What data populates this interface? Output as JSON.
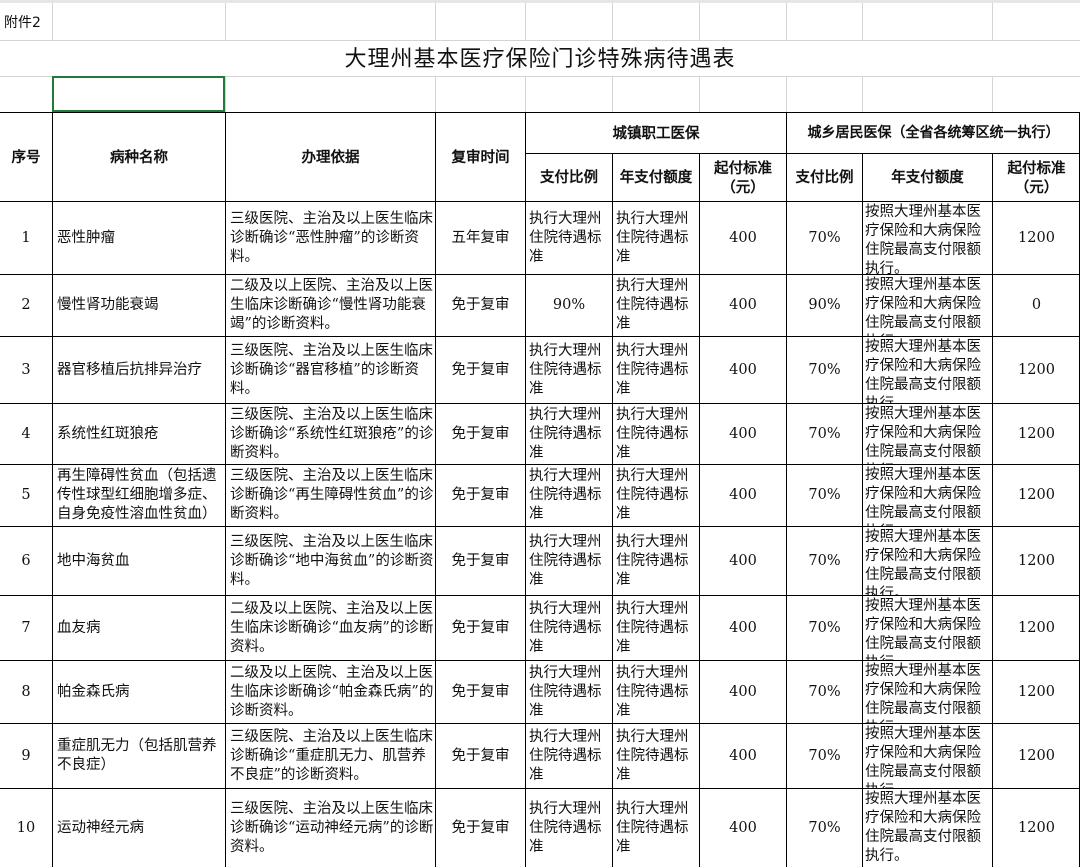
{
  "annex_label": "附件2",
  "title": "大理州基本医疗保险门诊特殊病待遇表",
  "headers": {
    "seq": "序号",
    "disease": "病种名称",
    "basis": "办理依据",
    "review": "复审时间",
    "urban_group": "城镇职工医保",
    "rural_group": "城乡居民医保（全省各统筹区统一执行）",
    "urban_ratio": "支付比例",
    "urban_annual": "年支付额度",
    "urban_threshold": "起付标准（元）",
    "rural_ratio": "支付比例",
    "rural_annual": "年支付额度",
    "rural_threshold": "起付标准（元）"
  },
  "rows": [
    {
      "no": "1",
      "disease": "恶性肿瘤",
      "basis": "三级医院、主治及以上医生临床诊断确诊“恶性肿瘤”的诊断资料。",
      "review": "五年复审",
      "urban_ratio": "执行大理州住院待遇标准",
      "urban_annual": "执行大理州住院待遇标准",
      "urban_threshold": "400",
      "rural_ratio": "70%",
      "rural_annual": "按照大理州基本医疗保险和大病保险住院最高支付限额执行。",
      "rural_threshold": "1200"
    },
    {
      "no": "2",
      "disease": "慢性肾功能衰竭",
      "basis": "二级及以上医院、主治及以上医生临床诊断确诊“慢性肾功能衰竭”的诊断资料。",
      "review": "免于复审",
      "urban_ratio": "90%",
      "urban_annual": "执行大理州住院待遇标准",
      "urban_threshold": "400",
      "rural_ratio": "90%",
      "rural_annual": "按照大理州基本医疗保险和大病保险住院最高支付限额执行。",
      "rural_threshold": "0"
    },
    {
      "no": "3",
      "disease": "器官移植后抗排异治疗",
      "basis": "三级医院、主治及以上医生临床诊断确诊“器官移植”的诊断资料。",
      "review": "免于复审",
      "urban_ratio": "执行大理州住院待遇标准",
      "urban_annual": "执行大理州住院待遇标准",
      "urban_threshold": "400",
      "rural_ratio": "70%",
      "rural_annual": "按照大理州基本医疗保险和大病保险住院最高支付限额执行。",
      "rural_threshold": "1200"
    },
    {
      "no": "4",
      "disease": "系统性红斑狼疮",
      "basis": "三级医院、主治及以上医生临床诊断确诊“系统性红斑狼疮”的诊断资料。",
      "review": "免于复审",
      "urban_ratio": "执行大理州住院待遇标准",
      "urban_annual": "执行大理州住院待遇标准",
      "urban_threshold": "400",
      "rural_ratio": "70%",
      "rural_annual": "按照大理州基本医疗保险和大病保险住院最高支付限额执行。",
      "rural_threshold": "1200"
    },
    {
      "no": "5",
      "disease": "再生障碍性贫血（包括遗传性球型红细胞增多症、自身免疫性溶血性贫血）",
      "basis": "三级医院、主治及以上医生临床诊断确诊“再生障碍性贫血”的诊断资料。",
      "review": "免于复审",
      "urban_ratio": "执行大理州住院待遇标准",
      "urban_annual": "执行大理州住院待遇标准",
      "urban_threshold": "400",
      "rural_ratio": "70%",
      "rural_annual": "按照大理州基本医疗保险和大病保险住院最高支付限额执行。",
      "rural_threshold": "1200"
    },
    {
      "no": "6",
      "disease": "地中海贫血",
      "basis": "三级医院、主治及以上医生临床诊断确诊“地中海贫血”的诊断资料。",
      "review": "免于复审",
      "urban_ratio": "执行大理州住院待遇标准",
      "urban_annual": "执行大理州住院待遇标准",
      "urban_threshold": "400",
      "rural_ratio": "70%",
      "rural_annual": "按照大理州基本医疗保险和大病保险住院最高支付限额执行。",
      "rural_threshold": "1200"
    },
    {
      "no": "7",
      "disease": "血友病",
      "basis": "二级及以上医院、主治及以上医生临床诊断确诊“血友病”的诊断资料。",
      "review": "免于复审",
      "urban_ratio": "执行大理州住院待遇标准",
      "urban_annual": "执行大理州住院待遇标准",
      "urban_threshold": "400",
      "rural_ratio": "70%",
      "rural_annual": "按照大理州基本医疗保险和大病保险住院最高支付限额执行。",
      "rural_threshold": "1200"
    },
    {
      "no": "8",
      "disease": "帕金森氏病",
      "basis": "二级及以上医院、主治及以上医生临床诊断确诊“帕金森氏病”的诊断资料。",
      "review": "免于复审",
      "urban_ratio": "执行大理州住院待遇标准",
      "urban_annual": "执行大理州住院待遇标准",
      "urban_threshold": "400",
      "rural_ratio": "70%",
      "rural_annual": "按照大理州基本医疗保险和大病保险住院最高支付限额执行。",
      "rural_threshold": "1200"
    },
    {
      "no": "9",
      "disease": "重症肌无力（包括肌营养不良症）",
      "basis": "三级医院、主治及以上医生临床诊断确诊“重症肌无力、肌营养不良症”的诊断资料。",
      "review": "免于复审",
      "urban_ratio": "执行大理州住院待遇标准",
      "urban_annual": "执行大理州住院待遇标准",
      "urban_threshold": "400",
      "rural_ratio": "70%",
      "rural_annual": "按照大理州基本医疗保险和大病保险住院最高支付限额执行。",
      "rural_threshold": "1200"
    },
    {
      "no": "10",
      "disease": "运动神经元病",
      "basis": "三级医院、主治及以上医生临床诊断确诊“运动神经元病”的诊断资料。",
      "review": "免于复审",
      "urban_ratio": "执行大理州住院待遇标准",
      "urban_annual": "执行大理州住院待遇标准",
      "urban_threshold": "400",
      "rural_ratio": "70%",
      "rural_annual": "按照大理州基本医疗保险和大病保险住院最高支付限额执行。",
      "rural_threshold": "1200"
    }
  ]
}
